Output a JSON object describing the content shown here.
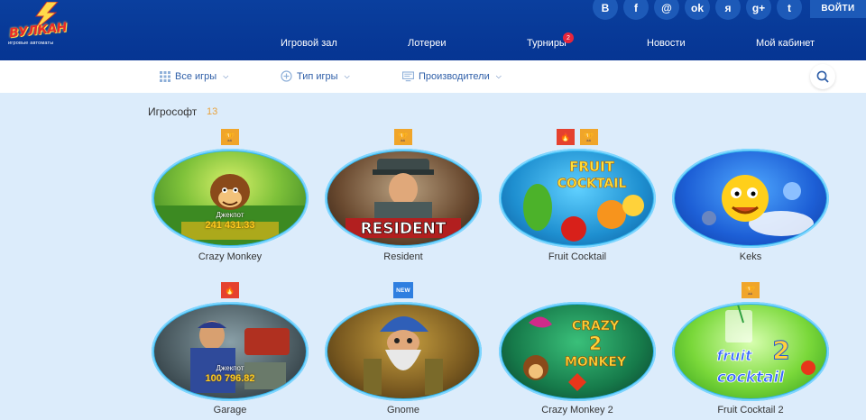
{
  "header": {
    "logo_text": "ВУЛКАН",
    "logo_sub": "игровые автоматы",
    "social": [
      {
        "icon": "vk-icon",
        "glyph": "В"
      },
      {
        "icon": "facebook-icon",
        "glyph": "f"
      },
      {
        "icon": "mail-icon",
        "glyph": "@"
      },
      {
        "icon": "odnoklassniki-icon",
        "glyph": "ok"
      },
      {
        "icon": "yandex-icon",
        "glyph": "я"
      },
      {
        "icon": "google-plus-icon",
        "glyph": "g+"
      },
      {
        "icon": "twitter-icon",
        "glyph": "t"
      }
    ],
    "login_label": "ВОЙТИ",
    "nav": {
      "hall": "Игровой зал",
      "lottery": "Лотереи",
      "tournaments": "Турниры",
      "tournaments_badge": "2",
      "news": "Новости",
      "cabinet": "Мой кабинет"
    }
  },
  "filters": {
    "all_games": "Все игры",
    "game_type": "Тип игры",
    "providers": "Производители"
  },
  "section": {
    "title": "Игрософт",
    "count": "13"
  },
  "games": [
    {
      "name": "Crazy Monkey",
      "badges": [
        "trophy"
      ],
      "jackpot_label": "Джекпот",
      "jackpot_value": "241 431.33"
    },
    {
      "name": "Resident",
      "badges": [
        "trophy"
      ]
    },
    {
      "name": "Fruit Cocktail",
      "badges": [
        "hot",
        "trophy"
      ]
    },
    {
      "name": "Keks",
      "badges": []
    },
    {
      "name": "Garage",
      "badges": [
        "hot"
      ],
      "jackpot_label": "Джекпот",
      "jackpot_value": "100 796.82"
    },
    {
      "name": "Gnome",
      "badges": [
        "new"
      ],
      "new_label": "NEW"
    },
    {
      "name": "Crazy Monkey 2",
      "badges": []
    },
    {
      "name": "Fruit Cocktail 2",
      "badges": [
        "trophy"
      ]
    }
  ],
  "art_text": {
    "resident": "RESIDENT",
    "fruit": "FRUIT",
    "cocktail": "COCKTAIL",
    "crazy": "CRAZY",
    "monkey": "MONKEY",
    "fruit2": "fruit",
    "cocktail2": "cocktail",
    "two": "2"
  },
  "colors": {
    "header_bg": "#063593",
    "nav_badge": "#e8253b",
    "trophy_badge": "#f0a52a",
    "hot_badge": "#e5412e",
    "new_badge": "#2f7fe0",
    "jackpot_value": "#ffcb1f",
    "page_bg": "#dcecfb"
  }
}
